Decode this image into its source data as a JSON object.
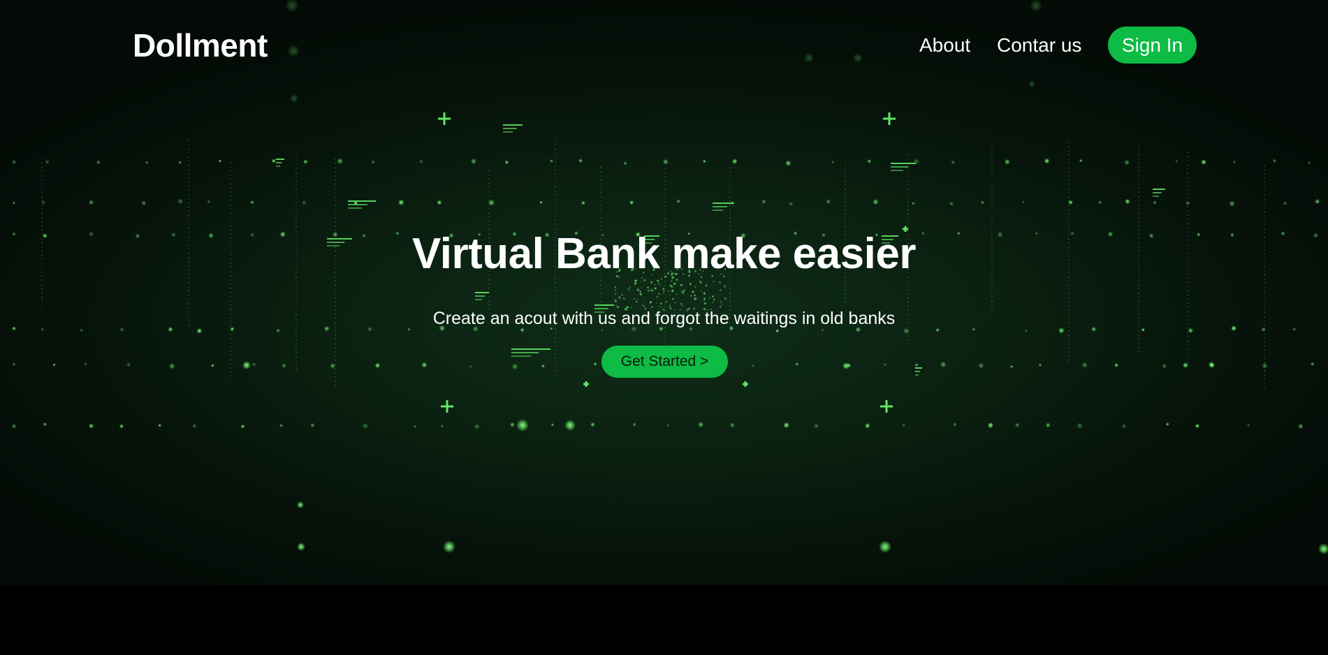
{
  "header": {
    "logo": "Dollment",
    "nav": {
      "about": "About",
      "contact": "Contar us"
    },
    "signin_label": "Sign In"
  },
  "hero": {
    "title": "Virtual Bank make easier",
    "subtitle": "Create an acout with us and forgot the waitings in old banks",
    "cta_label": "Get Started >"
  },
  "colors": {
    "accent": "#0dbb45",
    "background": "#06120a",
    "particle": "#6cff6c"
  }
}
